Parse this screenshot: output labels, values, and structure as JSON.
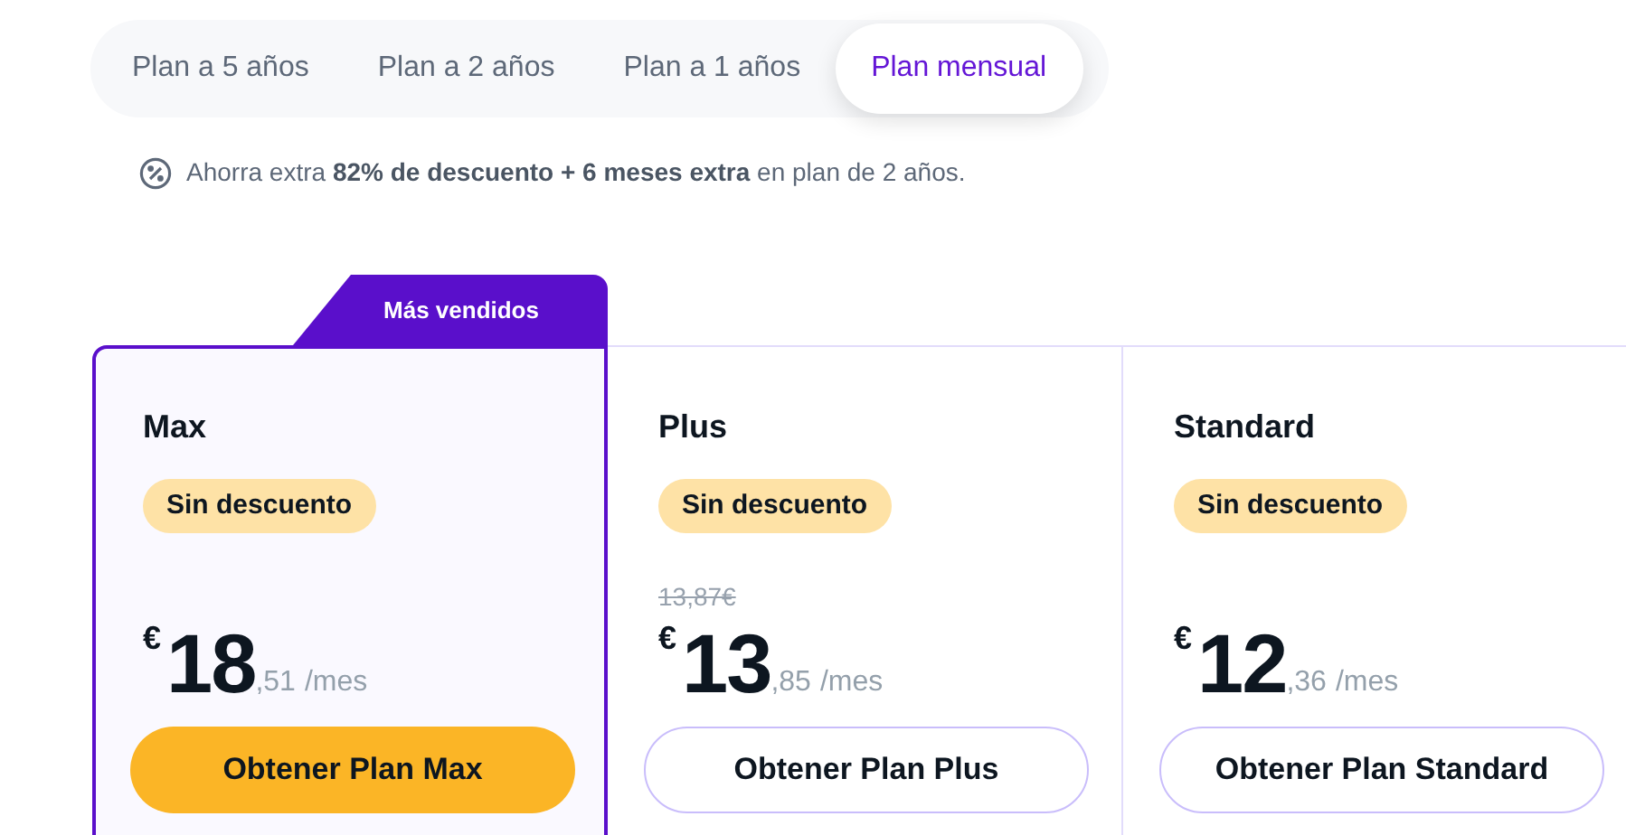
{
  "tabs": [
    {
      "label": "Plan a 5 años",
      "selected": false
    },
    {
      "label": "Plan a 2 años",
      "selected": false
    },
    {
      "label": "Plan a 1 años",
      "selected": false
    },
    {
      "label": "Plan mensual",
      "selected": true
    }
  ],
  "note": "Ahorra extra **82% de descuento + 6 meses extra** en plan de 2 años.",
  "plans": [
    {
      "name": "Max",
      "featured": true,
      "ribbon": "Más vendidos",
      "badge": "Sin descuento",
      "currency": "€",
      "price": "18",
      "cents": ",51",
      "period": "/mes",
      "button": "Obtener Plan Max"
    },
    {
      "name": "Plus",
      "featured": false,
      "badge": "Sin descuento",
      "old_price": "13,87€",
      "currency": "€",
      "price": "13",
      "cents": ",85",
      "period": "/mes",
      "button": "Obtener Plan Plus"
    },
    {
      "name": "Standard",
      "featured": false,
      "badge": "Sin descuento",
      "currency": "€",
      "price": "12",
      "cents": ",36",
      "period": "/mes",
      "button": "Obtener Plan Standard"
    }
  ]
}
